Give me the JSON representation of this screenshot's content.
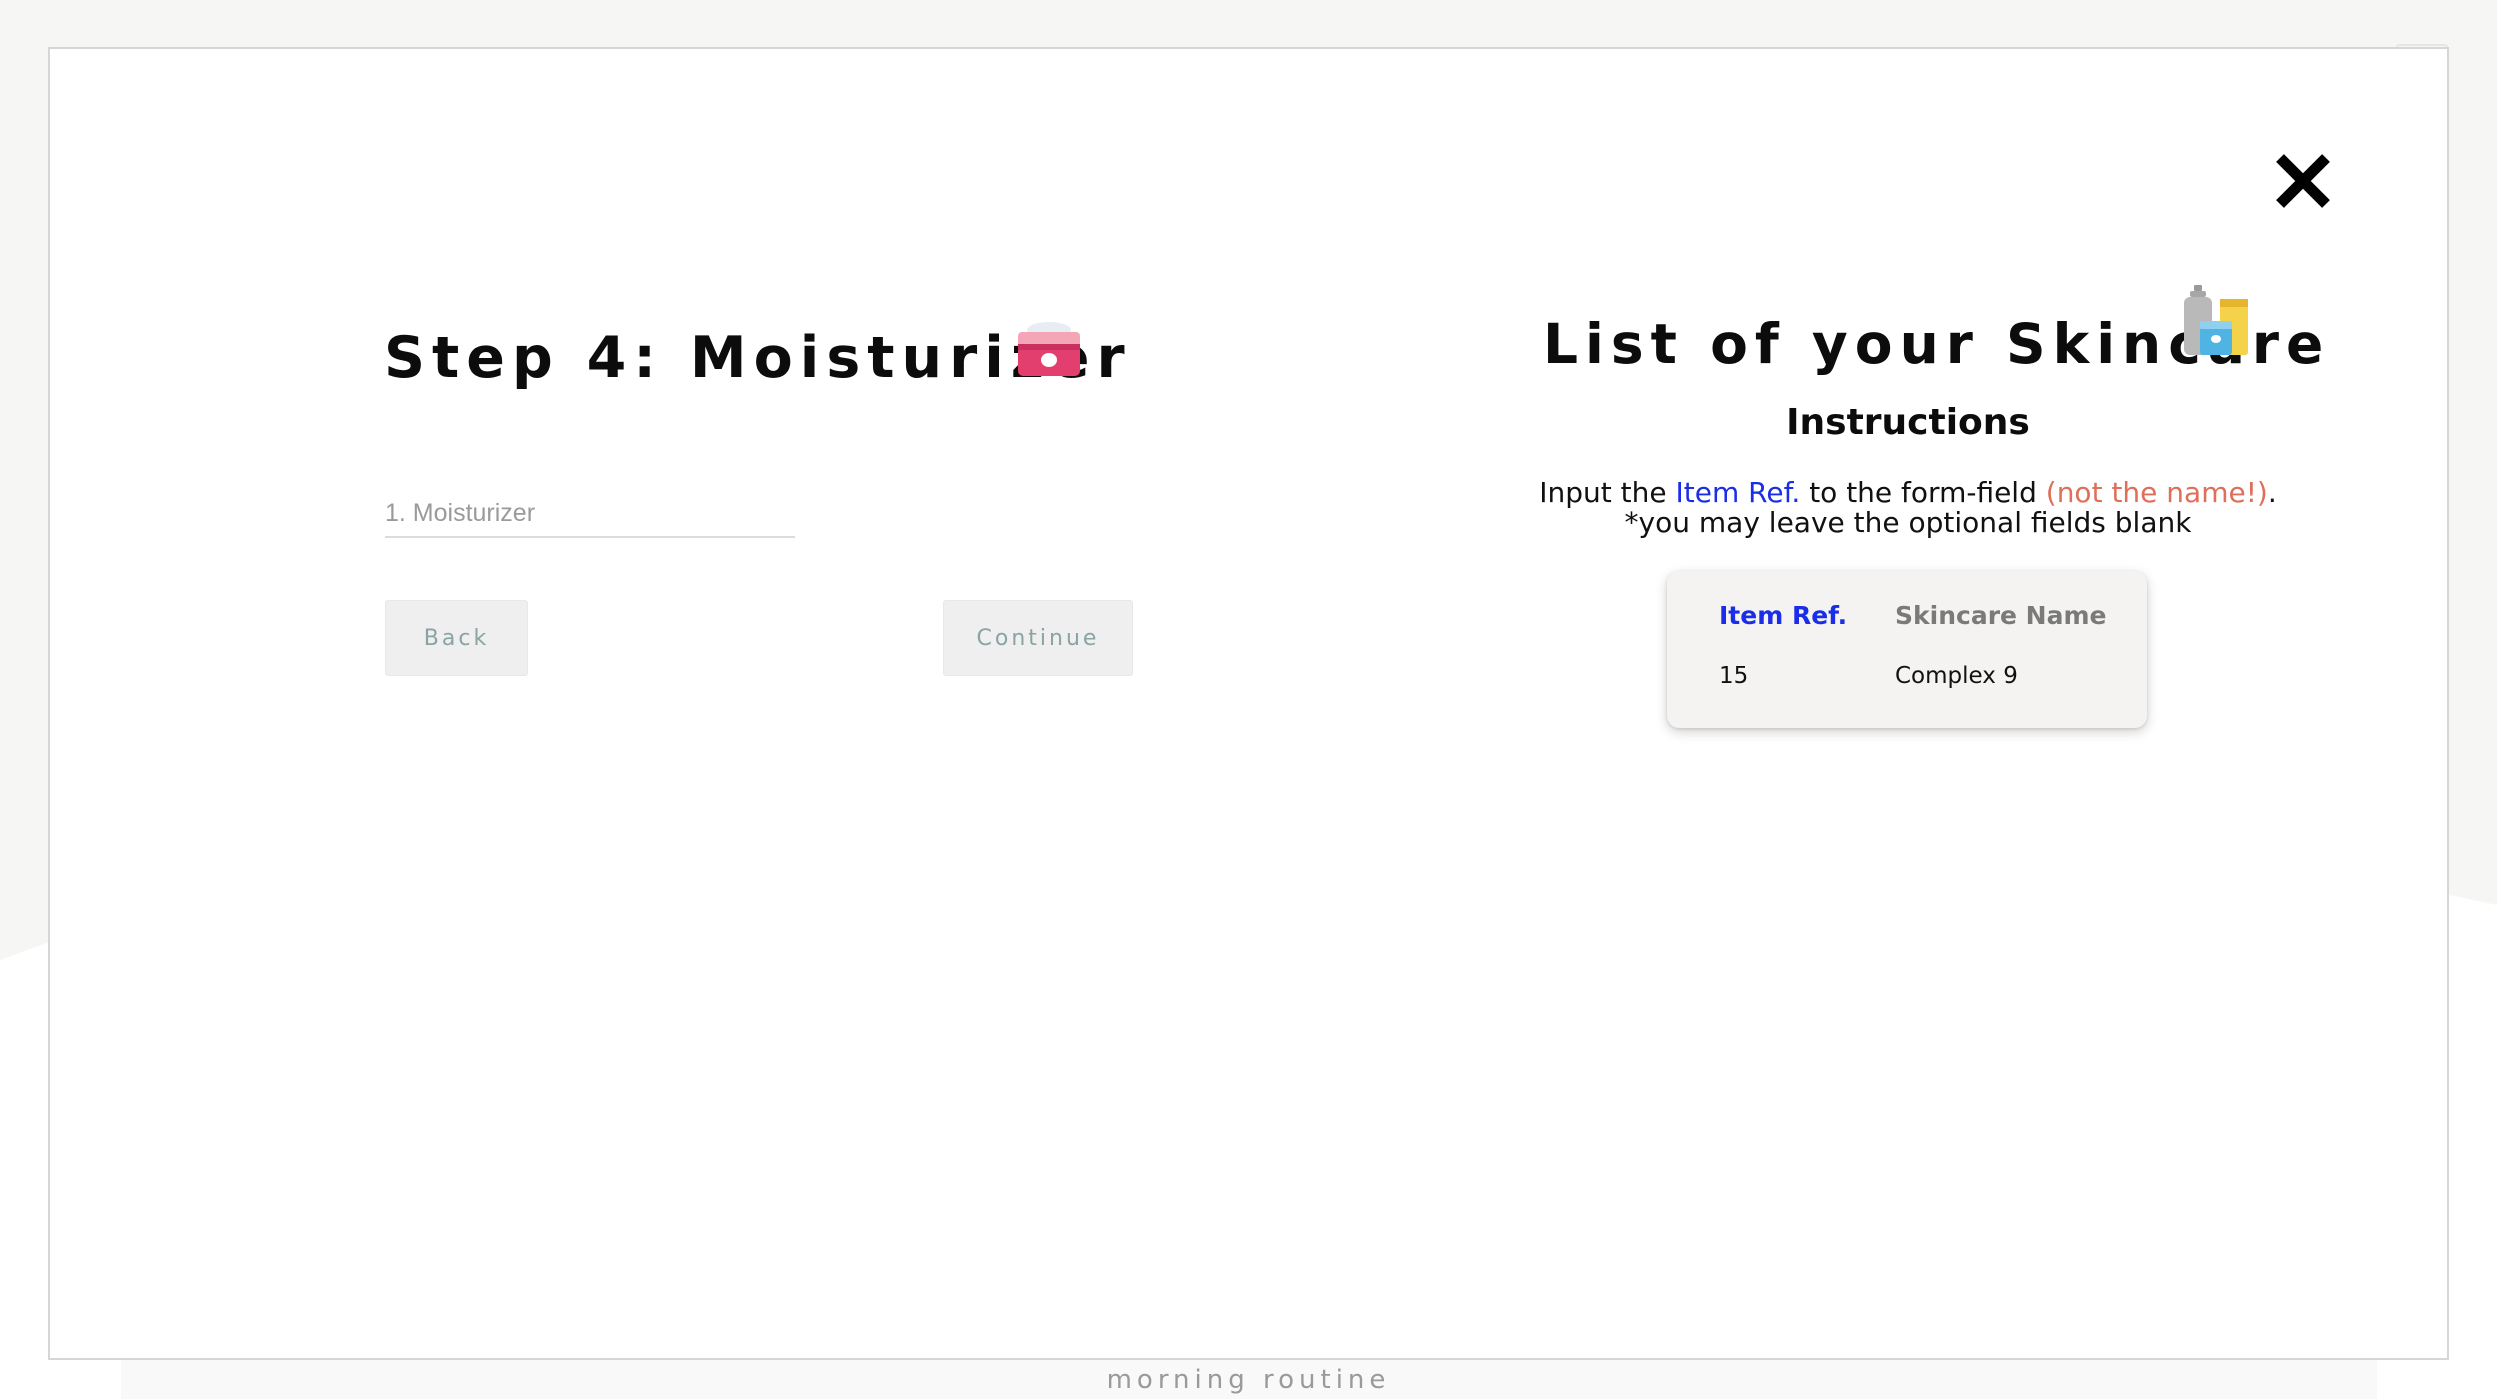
{
  "modal": {
    "close_icon": "close-icon",
    "step_title": "Step 4: Moisturizer",
    "step_icon": "moisturizer-jar-icon",
    "input": {
      "placeholder": "1. Moisturizer",
      "value": ""
    },
    "buttons": {
      "back": "Back",
      "continue": "Continue"
    },
    "list_title": "List of your Skincare",
    "list_icon": "skincare-bottles-icon",
    "instructions": {
      "heading": "Instructions",
      "line1_prefix": "Input the ",
      "line1_ref": "Item Ref.",
      "line1_middle": " to the form-field ",
      "line1_warning": "(not the name!)",
      "line1_suffix": ".",
      "line2": "*you may leave the optional fields blank"
    },
    "table": {
      "headers": [
        "Item Ref.",
        "Skincare Name"
      ],
      "rows": [
        {
          "ref": "15",
          "name": "Complex 9"
        }
      ]
    }
  },
  "footer": {
    "label": "morning routine"
  },
  "colors": {
    "accent_blue": "#1a2ee8",
    "warning_salmon": "#e06f5a",
    "button_text": "#8aa3a3",
    "card_bg": "#f4f3f1"
  }
}
